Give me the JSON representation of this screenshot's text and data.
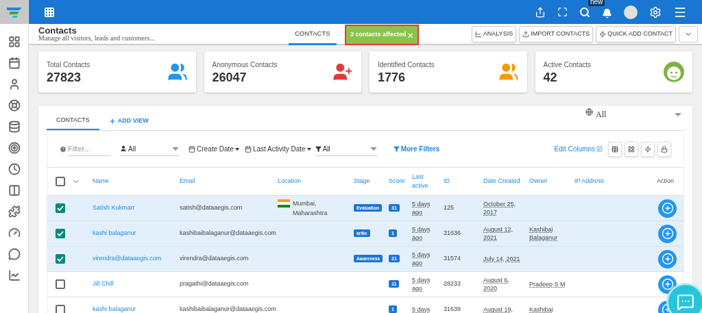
{
  "topbar": {
    "new_badge": "new"
  },
  "header": {
    "title": "Contacts",
    "subtitle": "Manage all visitors, leads and customers...",
    "tabs": [
      {
        "label": "CONTACTS",
        "selected": true
      }
    ],
    "toast": {
      "text": "3 contacts affected",
      "close": "×"
    },
    "buttons": [
      "ANALYSIS",
      "IMPORT CONTACTS",
      "QUICK ADD CONTACT"
    ]
  },
  "sidebar": {
    "items": [
      {
        "kind": "dashboard",
        "selected": false
      },
      {
        "kind": "calendar",
        "selected": false
      },
      {
        "kind": "user",
        "selected": false
      },
      {
        "kind": "support",
        "selected": false
      },
      {
        "kind": "database",
        "selected": false
      },
      {
        "kind": "target",
        "selected": false
      },
      {
        "kind": "clock",
        "selected": false
      },
      {
        "kind": "columns",
        "selected": false
      },
      {
        "kind": "puzzle",
        "selected": false
      },
      {
        "kind": "gauge",
        "selected": false
      },
      {
        "kind": "chat",
        "selected": false
      },
      {
        "kind": "chart",
        "selected": false
      }
    ]
  },
  "stats": [
    {
      "label": "Total Contacts",
      "value": "27823",
      "kind": "group",
      "color": "#2196f3"
    },
    {
      "label": "Anonymous Contacts",
      "value": "26047",
      "kind": "add-user",
      "color": "#e53935"
    },
    {
      "label": "Identified Contacts",
      "value": "1776",
      "kind": "group",
      "color": "#ff9800"
    },
    {
      "label": "Active Contacts",
      "value": "42",
      "kind": "face",
      "color": "#7cb342"
    }
  ],
  "view_tabs": [
    {
      "label": "CONTACTS",
      "selected": true
    },
    {
      "label": "ADD VIEW",
      "selected": false
    }
  ],
  "scope": {
    "value": "All"
  },
  "filters": {
    "placeholder": "Filter...",
    "owner": "All",
    "create_date": "Create Date",
    "last_activity": "Last Activity Date",
    "type": "All",
    "more": "More Filters",
    "edit_columns": "Edit Columns"
  },
  "table": {
    "columns": [
      "Name",
      "Email",
      "Location",
      "Stage",
      "Score",
      "Last active",
      "ID",
      "Date Created",
      "Owner",
      "IP Address",
      "Action"
    ],
    "select_all": false,
    "rows": [
      {
        "selected": true,
        "name": "Satish Kukmarr",
        "email": "satish@dataaegis.com",
        "location": "Mumbai, Maharashtra",
        "stage": "Evaluation",
        "score": "31",
        "last_active": "5 days ago",
        "id": "125",
        "date_created": "October 25, 2017",
        "owner": ""
      },
      {
        "selected": true,
        "name": "kashi balaganur",
        "email": "kashibaibalaganur@dataaegis.com",
        "location": "",
        "stage": "aritic",
        "score": "1",
        "last_active": "5 days ago",
        "id": "31636",
        "date_created": "August 12, 2021",
        "owner": "Kashibai Balaganur"
      },
      {
        "selected": true,
        "name": "virendra@dataaegis.com",
        "email": "virendra@dataaegis.com",
        "location": "",
        "stage": "Awareness",
        "score": "21",
        "last_active": "5 days ago",
        "id": "31574",
        "date_created": "July 14, 2021",
        "owner": ""
      },
      {
        "selected": false,
        "name": "Jill Chill",
        "email": "pragathi@dataaegis.com",
        "location": "",
        "stage": "",
        "score": "11",
        "last_active": "5 days ago",
        "id": "28233",
        "date_created": "August 6, 2020",
        "owner": "Pradeep S M"
      },
      {
        "selected": false,
        "name": "kashi balaganur",
        "email": "kashibaibalaganur@dataaegis.com",
        "location": "",
        "stage": "",
        "score": "1",
        "last_active": "5 days",
        "id": "31639",
        "date_created": "August 19,",
        "owner": "Kashibai"
      }
    ]
  }
}
